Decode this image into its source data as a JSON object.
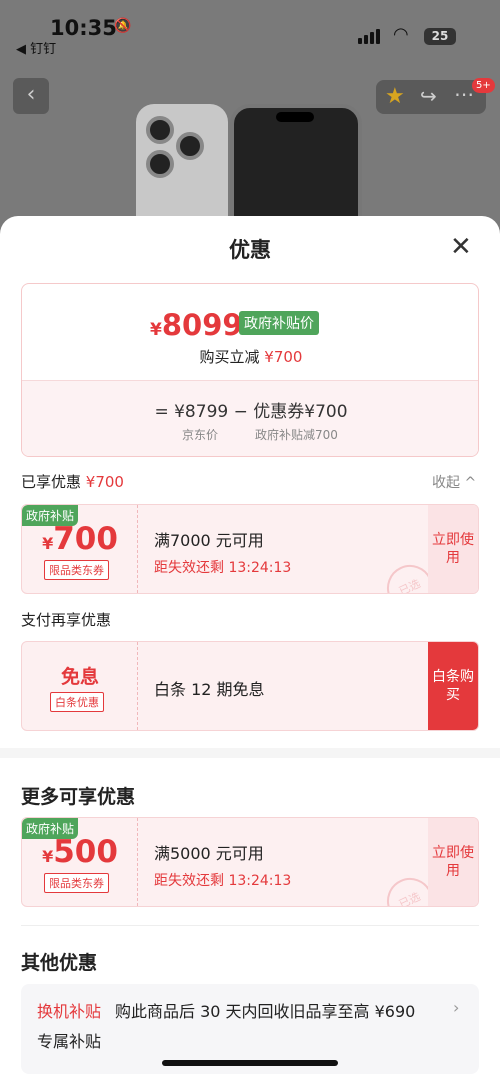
{
  "status_bar": {
    "time": "10:35",
    "back_app": "◀ 钉钉",
    "battery": "25"
  },
  "background_page": {
    "cart_badge": "5+"
  },
  "sheet": {
    "title": "优惠"
  },
  "summary": {
    "currency": "¥",
    "final_price": "8099",
    "gov_tag": "政府补贴价",
    "discount_label": "购买立减",
    "discount_value": "¥700",
    "equation": "= ¥8799 − 优惠券¥700",
    "jd_price_label": "京东价",
    "gov_reduce_label": "政府补贴减700"
  },
  "enjoyed": {
    "label": "已享优惠",
    "value": "¥700",
    "collapse_label": "收起 ^"
  },
  "coupons": [
    {
      "gov": "政府补贴",
      "currency": "¥",
      "amount": "700",
      "type": "限品类东券",
      "condition": "满7000 元可用",
      "expiry": "距失效还剩 13:24:13",
      "action": "立即使用",
      "stamp": "已选"
    },
    {
      "gov": "政府补贴",
      "currency": "¥",
      "amount": "500",
      "type": "限品类东券",
      "condition": "满5000 元可用",
      "expiry": "距失效还剩 13:24:13",
      "action": "立即使用",
      "stamp": "已选"
    }
  ],
  "pay": {
    "section_label": "支付再享优惠",
    "title": "免息",
    "tag": "白条优惠",
    "text": "白条 12 期免息",
    "action": "白条购买"
  },
  "more": {
    "title": "更多可享优惠"
  },
  "other": {
    "title": "其他优惠",
    "item_tag": "换机补贴",
    "item_desc": "购此商品后 30 天内回收旧品享至高 ¥690",
    "item_desc2": "专属补贴"
  },
  "colors": {
    "accent": "#e4393c",
    "gov_green": "#4fa55b"
  }
}
